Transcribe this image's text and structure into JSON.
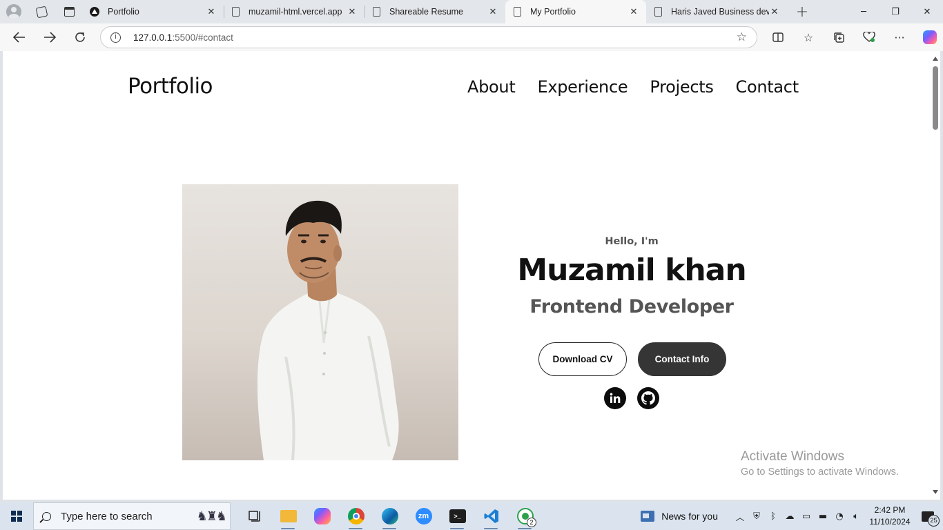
{
  "browser": {
    "tabs": [
      {
        "title": "Portfolio",
        "icon": "triangle-icon"
      },
      {
        "title": "muzamil-html.vercel.app",
        "icon": "page-icon"
      },
      {
        "title": "Shareable Resume",
        "icon": "page-icon"
      },
      {
        "title": "My Portfolio",
        "icon": "page-icon",
        "active": true
      },
      {
        "title": "Haris Javed Business devel",
        "icon": "page-icon"
      }
    ],
    "url_host": "127.0.0.1",
    "url_rest": ":5500/#contact",
    "info_glyph": "i"
  },
  "site": {
    "logo": "Portfolio",
    "nav": [
      "About",
      "Experience",
      "Projects",
      "Contact"
    ],
    "hero": {
      "greeting": "Hello, I'm",
      "name": "Muzamil khan",
      "role": "Frontend Developer",
      "download_cv": "Download CV",
      "contact_info": "Contact Info"
    },
    "socials": [
      "linkedin-icon",
      "github-icon"
    ]
  },
  "watermark": {
    "line1": "Activate Windows",
    "line2": "Go to Settings to activate Windows."
  },
  "taskbar": {
    "search_placeholder": "Type here to search",
    "news": "News for you",
    "time": "2:42 PM",
    "date": "11/10/2024",
    "whatsapp_badge": "2",
    "notification_count": "25",
    "zoom_label": "zm"
  },
  "colors": {
    "button_dark": "#353535",
    "text_muted": "#555555",
    "tab_strip": "#e3e6ea",
    "taskbar": "#dbe4ee"
  }
}
